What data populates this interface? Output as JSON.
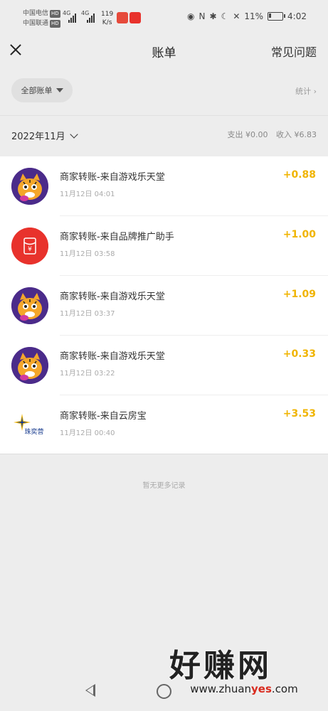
{
  "status": {
    "carrier1": "中国电信",
    "carrier2": "中国联通",
    "hd": "HD",
    "network1": "4G",
    "network2": "4G",
    "speed_value": "119",
    "speed_unit": "K/s",
    "nfc": "N",
    "battery": "11%",
    "time": "4:02"
  },
  "nav": {
    "title": "账单",
    "faq_label": "常见问题"
  },
  "filter": {
    "all_bills_label": "全部账单",
    "stats_label": "统计"
  },
  "period": {
    "month_label": "2022年11月",
    "expense": "支出 ¥0.00",
    "income": "收入 ¥6.83"
  },
  "transactions": [
    {
      "title": "商家转账-来自游戏乐天堂",
      "time": "11月12日 04:01",
      "amount": "+0.88",
      "avatar": "tiger-avatar"
    },
    {
      "title": "商家转账-来自品牌推广助手",
      "time": "11月12日 03:58",
      "amount": "+1.00",
      "avatar": "red-envelope-avatar"
    },
    {
      "title": "商家转账-来自游戏乐天堂",
      "time": "11月12日 03:37",
      "amount": "+1.09",
      "avatar": "tiger-avatar"
    },
    {
      "title": "商家转账-来自游戏乐天堂",
      "time": "11月12日 03:22",
      "amount": "+0.33",
      "avatar": "tiger-avatar"
    },
    {
      "title": "商家转账-来自云房宝",
      "time": "11月12日 00:40",
      "amount": "+3.53",
      "avatar": "star-logo-avatar",
      "logo_text": "珠奕营"
    }
  ],
  "empty_text": "暂无更多记录",
  "watermark": {
    "main": "好赚网",
    "url_prefix": "www.zhuan",
    "url_accent": "yes",
    "url_suffix": ".com"
  },
  "colors": {
    "amount": "#f0b400",
    "background": "#ededed",
    "red_envelope": "#e8322c"
  }
}
